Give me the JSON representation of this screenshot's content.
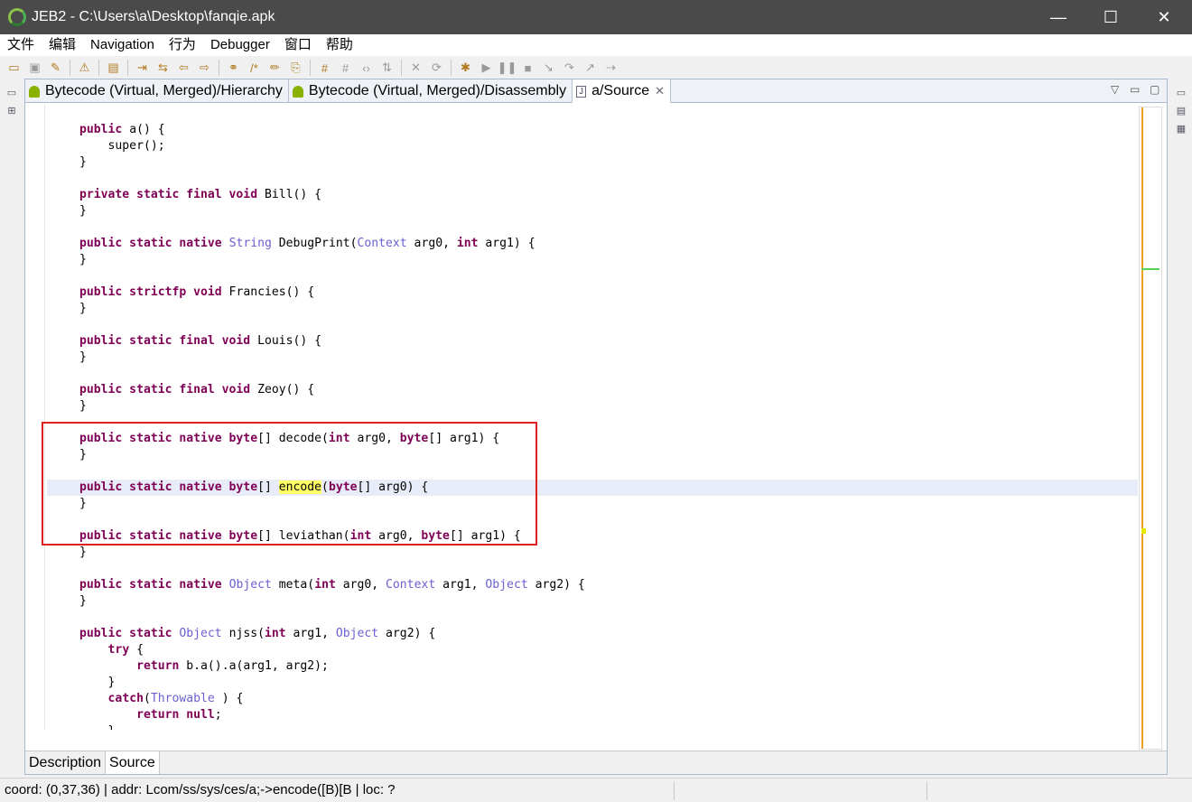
{
  "window": {
    "title": "JEB2 - C:\\Users\\a\\Desktop\\fanqie.apk",
    "minimize": "—",
    "maximize": "☐",
    "close": "✕"
  },
  "menu": [
    "文件",
    "编辑",
    "Navigation",
    "行为",
    "Debugger",
    "窗口",
    "帮助"
  ],
  "tabs": [
    {
      "label": "Bytecode (Virtual, Merged)/Hierarchy",
      "icon": "android-icon"
    },
    {
      "label": "Bytecode (Virtual, Merged)/Disassembly",
      "icon": "android-icon"
    },
    {
      "label": "a/Source",
      "icon": "java-file-icon",
      "close": "✕"
    }
  ],
  "bottom_tabs": [
    "Description",
    "Source"
  ],
  "status": "coord: (0,37,36) | addr: Lcom/ss/sys/ces/a;->encode([B)[B | loc: ?",
  "code": [
    [
      [
        "public",
        "kw"
      ],
      [
        " a() {",
        "t"
      ]
    ],
    [
      [
        "    super();",
        "t"
      ]
    ],
    [
      [
        "}",
        "t"
      ]
    ],
    [],
    [
      [
        "private static final void",
        "kw"
      ],
      [
        " Bill() {",
        "t"
      ]
    ],
    [
      [
        "}",
        "t"
      ]
    ],
    [],
    [
      [
        "public static native",
        "kw"
      ],
      [
        " ",
        "t"
      ],
      [
        "String",
        "ty"
      ],
      [
        " DebugPrint(",
        "t"
      ],
      [
        "Context",
        "ty"
      ],
      [
        " arg0, ",
        "t"
      ],
      [
        "int",
        "kw"
      ],
      [
        " arg1) {",
        "t"
      ]
    ],
    [
      [
        "}",
        "t"
      ]
    ],
    [],
    [
      [
        "public strictfp void",
        "kw"
      ],
      [
        " Francies() {",
        "t"
      ]
    ],
    [
      [
        "}",
        "t"
      ]
    ],
    [],
    [
      [
        "public static final void",
        "kw"
      ],
      [
        " Louis() {",
        "t"
      ]
    ],
    [
      [
        "}",
        "t"
      ]
    ],
    [],
    [
      [
        "public static final void",
        "kw"
      ],
      [
        " Zeoy() {",
        "t"
      ]
    ],
    [
      [
        "}",
        "t"
      ]
    ],
    [],
    [
      [
        "public static native byte",
        "kw"
      ],
      [
        "[] decode(",
        "t"
      ],
      [
        "int",
        "kw"
      ],
      [
        " arg0, ",
        "t"
      ],
      [
        "byte",
        "kw"
      ],
      [
        "[] arg1) {",
        "t"
      ]
    ],
    [
      [
        "}",
        "t"
      ]
    ],
    [],
    [
      [
        "public static native byte",
        "kw"
      ],
      [
        "[] ",
        "t"
      ],
      [
        "encode",
        "hl"
      ],
      [
        "(",
        "t"
      ],
      [
        "byte",
        "kw"
      ],
      [
        "[] arg0) {",
        "t"
      ]
    ],
    [
      [
        "}",
        "t"
      ]
    ],
    [],
    [
      [
        "public static native byte",
        "kw"
      ],
      [
        "[] leviathan(",
        "t"
      ],
      [
        "int",
        "kw"
      ],
      [
        " arg0, ",
        "t"
      ],
      [
        "byte",
        "kw"
      ],
      [
        "[] arg1) {",
        "t"
      ]
    ],
    [
      [
        "}",
        "t"
      ]
    ],
    [],
    [
      [
        "public static native",
        "kw"
      ],
      [
        " ",
        "t"
      ],
      [
        "Object",
        "ty"
      ],
      [
        " meta(",
        "t"
      ],
      [
        "int",
        "kw"
      ],
      [
        " arg0, ",
        "t"
      ],
      [
        "Context",
        "ty"
      ],
      [
        " arg1, ",
        "t"
      ],
      [
        "Object",
        "ty"
      ],
      [
        " arg2) {",
        "t"
      ]
    ],
    [
      [
        "}",
        "t"
      ]
    ],
    [],
    [
      [
        "public static",
        "kw"
      ],
      [
        " ",
        "t"
      ],
      [
        "Object",
        "ty"
      ],
      [
        " njss(",
        "t"
      ],
      [
        "int",
        "kw"
      ],
      [
        " arg1, ",
        "t"
      ],
      [
        "Object",
        "ty"
      ],
      [
        " arg2) {",
        "t"
      ]
    ],
    [
      [
        "    ",
        "t"
      ],
      [
        "try",
        "kw"
      ],
      [
        " {",
        "t"
      ]
    ],
    [
      [
        "        ",
        "t"
      ],
      [
        "return",
        "kw"
      ],
      [
        " b.a().a(arg1, arg2);",
        "t"
      ]
    ],
    [
      [
        "    }",
        "t"
      ]
    ],
    [
      [
        "    ",
        "t"
      ],
      [
        "catch",
        "kw"
      ],
      [
        "(",
        "t"
      ],
      [
        "Throwable",
        "ty"
      ],
      [
        " ) {",
        "t"
      ]
    ],
    [
      [
        "        ",
        "t"
      ],
      [
        "return null",
        "kw"
      ],
      [
        ";",
        "t"
      ]
    ],
    [
      [
        "    }",
        "t"
      ]
    ]
  ]
}
